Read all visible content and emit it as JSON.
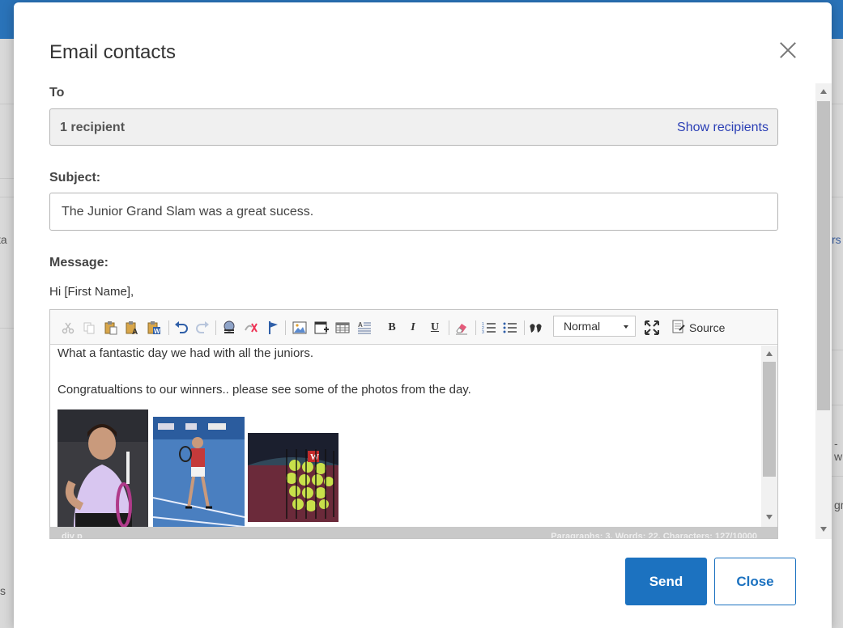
{
  "modal": {
    "title": "Email contacts",
    "to_label": "To",
    "recipients_count": "1 recipient",
    "show_recipients": "Show recipients",
    "subject_label": "Subject:",
    "subject_value": "The Junior Grand Slam was a great sucess.",
    "message_label": "Message:",
    "greeting": "Hi [First Name],"
  },
  "editor": {
    "toolbar": {
      "icons": [
        "cut-icon",
        "copy-icon",
        "paste-icon",
        "paste-text-icon",
        "paste-word-icon",
        "undo-icon",
        "redo-icon",
        "link-icon",
        "unlink-icon",
        "anchor-icon",
        "image-icon",
        "iframe-icon",
        "table-icon",
        "horizontal-rule-icon",
        "bold-icon",
        "italic-icon",
        "underline-icon",
        "remove-format-icon",
        "numbered-list-icon",
        "bulleted-list-icon",
        "blockquote-icon",
        "maximize-icon",
        "source-icon"
      ],
      "bold": "B",
      "italic": "I",
      "underline": "U",
      "format_value": "Normal",
      "source_label": "Source"
    },
    "body": {
      "line1": "What a fantastic day we had with all the juniors.",
      "line2": "Congratualtions to our winners.. please see some of the photos from the day.",
      "photos": [
        "tennis-player-portrait",
        "tennis-player-on-court",
        "tennis-ball-basket"
      ]
    },
    "status": {
      "path": "div   p",
      "counts": "Paragraphs: 3, Words: 22, Characters: 127/10000"
    }
  },
  "footer": {
    "send": "Send",
    "close": "Close"
  },
  "background": {
    "fragment_left_1": "ta",
    "fragment_right_1": "rs",
    "fragment_right_2": "-w",
    "fragment_right_3": "gm",
    "fragment_left_2": "s"
  },
  "colors": {
    "primary": "#1c72c0",
    "link": "#2b3fb5",
    "topbar": "#2a73b9"
  }
}
